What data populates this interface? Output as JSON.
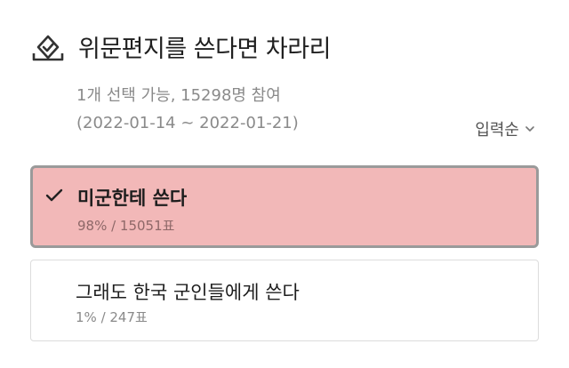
{
  "poll": {
    "title": "위문편지를 쓴다면 차라리",
    "info": "1개 선택 가능, 15298명 참여",
    "period": "(2022-01-14 ~ 2022-01-21)",
    "sort_label": "입력순",
    "icons": {
      "title": "ballot-check-icon",
      "sort": "chevron-down-icon",
      "selected": "checkmark-icon"
    },
    "colors": {
      "selected_fill": "#f2b8b8",
      "selected_border": "#9a9a9a",
      "option_border": "#dcdcdc"
    },
    "options": [
      {
        "label": "미군한테 쓴다",
        "result": "98% / 15051표",
        "percent": 98,
        "votes": 15051,
        "selected": true
      },
      {
        "label": "그래도 한국 군인들에게 쓴다",
        "result": "1% / 247표",
        "percent": 1,
        "votes": 247,
        "selected": false
      }
    ]
  }
}
